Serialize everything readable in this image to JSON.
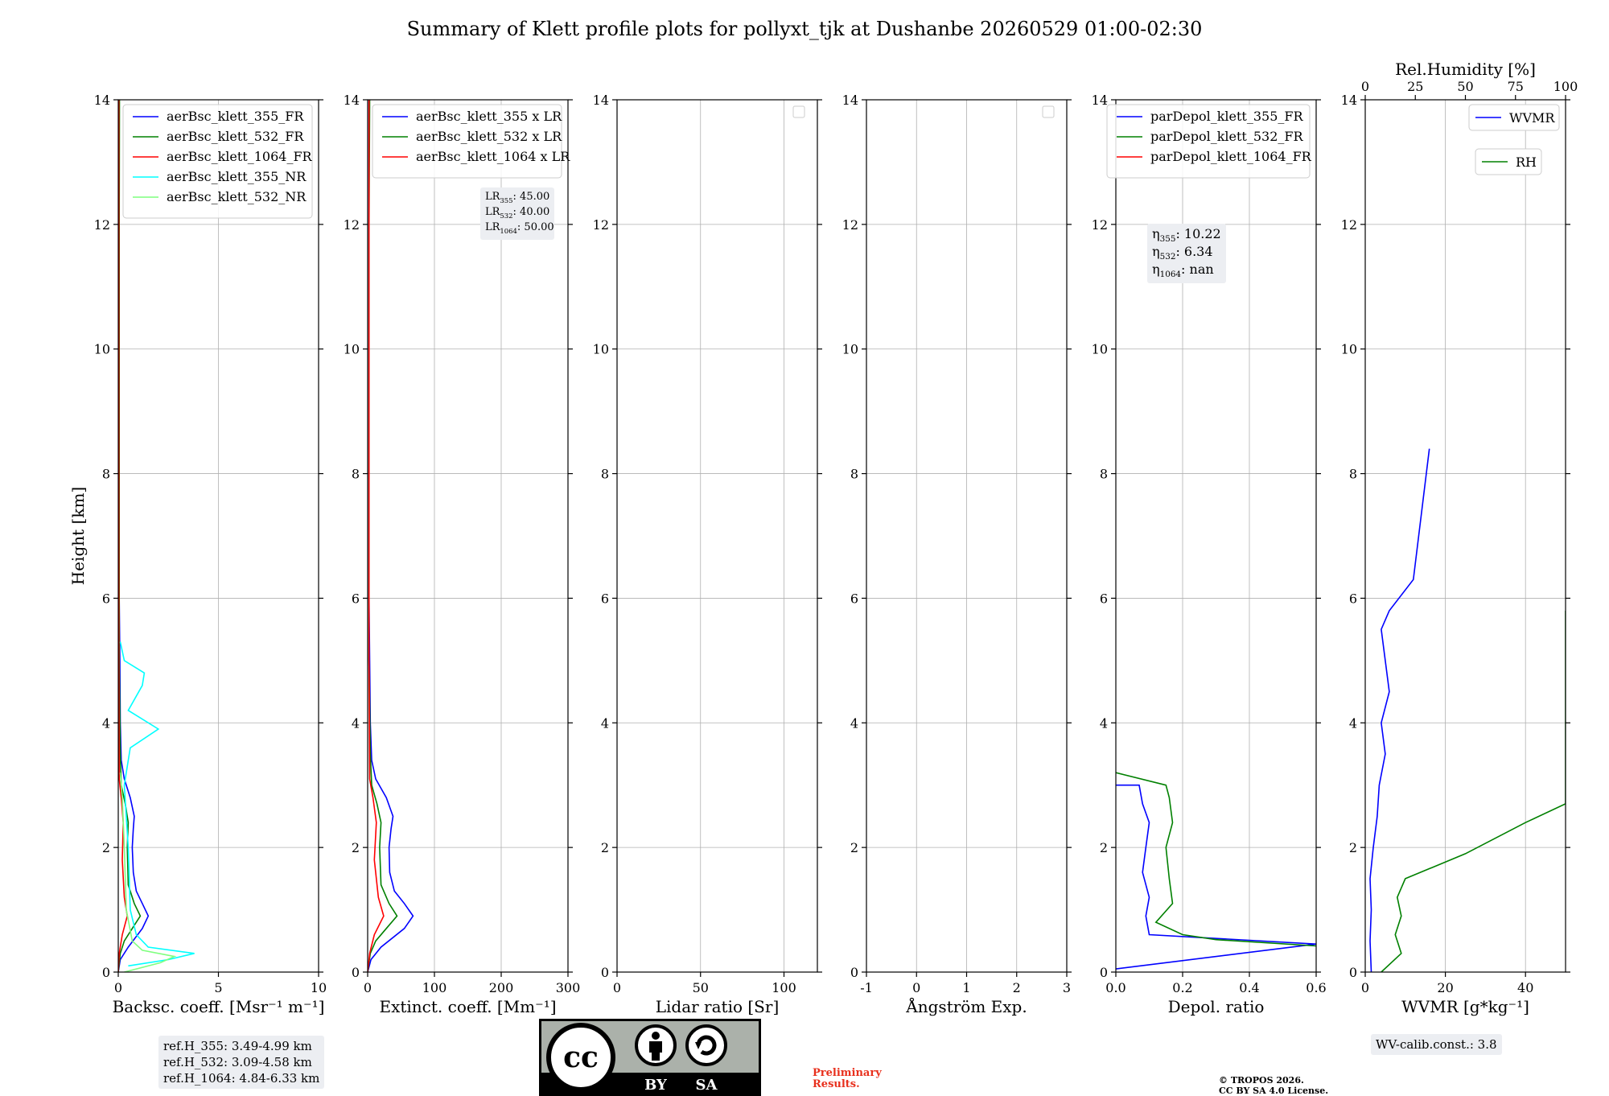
{
  "title": "Summary of Klett profile plots for pollyxt_tjk at Dushanbe 20260529 01:00-02:30",
  "colors": {
    "blue": "#0000ff",
    "green": "#008000",
    "red": "#ff0000",
    "cyan": "#00ffff",
    "lightgreen": "#7fff7f"
  },
  "shared_ylabel": "Height [km]",
  "reference_heights": [
    "ref.H_355: 3.49-4.99 km",
    "ref.H_532: 3.09-4.58 km",
    "ref.H_1064: 4.84-6.33 km"
  ],
  "wv_calib": "WV-calib.const.: 3.8",
  "preliminary": [
    "Preliminary",
    "Results."
  ],
  "copyright": [
    "© TROPOS 2026.",
    "CC BY SA 4.0 License."
  ],
  "license_badge": {
    "icon": "creative-commons-by-sa-badge",
    "by": "BY",
    "sa": "SA",
    "cc": "cc"
  },
  "chart_data": [
    {
      "type": "line",
      "xlabel": "Backsc. coeff. [Msr⁻¹ m⁻¹]",
      "ylabel": "Height [km]",
      "xlim": [
        0,
        10
      ],
      "ylim": [
        0,
        14
      ],
      "xticks": [
        0,
        5,
        10
      ],
      "yticks": [
        0,
        2,
        4,
        6,
        8,
        10,
        12,
        14
      ],
      "grid": true,
      "legend_placement": "top-right",
      "series": [
        {
          "name": "aerBsc_klett_355_FR",
          "color": "#0000ff",
          "points": [
            [
              0.0,
              0.0
            ],
            [
              0.1,
              0.2
            ],
            [
              0.5,
              0.4
            ],
            [
              1.2,
              0.7
            ],
            [
              1.5,
              0.9
            ],
            [
              1.2,
              1.1
            ],
            [
              0.9,
              1.3
            ],
            [
              0.75,
              1.6
            ],
            [
              0.7,
              2.0
            ],
            [
              0.75,
              2.3
            ],
            [
              0.8,
              2.5
            ],
            [
              0.6,
              2.8
            ],
            [
              0.3,
              3.1
            ],
            [
              0.15,
              3.4
            ],
            [
              0.1,
              4.0
            ],
            [
              0.08,
              5.0
            ],
            [
              0.05,
              6.0
            ],
            [
              0.05,
              7.0
            ],
            [
              0.05,
              8.0
            ],
            [
              0.04,
              10.0
            ],
            [
              0.04,
              12.0
            ],
            [
              0.05,
              14.0
            ]
          ]
        },
        {
          "name": "aerBsc_klett_532_FR",
          "color": "#008000",
          "points": [
            [
              0.0,
              0.0
            ],
            [
              0.1,
              0.3
            ],
            [
              0.3,
              0.5
            ],
            [
              0.7,
              0.7
            ],
            [
              1.1,
              0.9
            ],
            [
              0.8,
              1.1
            ],
            [
              0.5,
              1.4
            ],
            [
              0.45,
              2.0
            ],
            [
              0.5,
              2.4
            ],
            [
              0.35,
              2.7
            ],
            [
              0.15,
              3.0
            ],
            [
              0.1,
              3.5
            ],
            [
              0.05,
              5.0
            ],
            [
              0.05,
              8.0
            ],
            [
              0.05,
              12.0
            ],
            [
              0.06,
              14.0
            ]
          ]
        },
        {
          "name": "aerBsc_klett_1064_FR",
          "color": "#ff0000",
          "points": [
            [
              0.0,
              0.0
            ],
            [
              0.05,
              0.3
            ],
            [
              0.2,
              0.6
            ],
            [
              0.45,
              0.9
            ],
            [
              0.3,
              1.2
            ],
            [
              0.2,
              1.8
            ],
            [
              0.25,
              2.4
            ],
            [
              0.15,
              2.8
            ],
            [
              0.05,
              3.1
            ],
            [
              0.03,
              5.0
            ],
            [
              0.03,
              9.0
            ],
            [
              0.03,
              14.0
            ]
          ]
        },
        {
          "name": "aerBsc_klett_355_NR",
          "color": "#00ffff",
          "points": [
            [
              0.5,
              0.1
            ],
            [
              2.5,
              0.2
            ],
            [
              3.8,
              0.3
            ],
            [
              1.5,
              0.4
            ],
            [
              0.9,
              0.6
            ],
            [
              0.6,
              1.0
            ],
            [
              0.5,
              2.0
            ],
            [
              0.3,
              3.0
            ],
            [
              0.6,
              3.6
            ],
            [
              2.0,
              3.9
            ],
            [
              0.5,
              4.2
            ],
            [
              1.2,
              4.6
            ],
            [
              1.3,
              4.8
            ],
            [
              0.3,
              5.0
            ],
            [
              0.1,
              5.3
            ]
          ]
        },
        {
          "name": "aerBsc_klett_532_NR",
          "color": "#7fff7f",
          "points": [
            [
              0.3,
              0.0
            ],
            [
              2.1,
              0.15
            ],
            [
              2.8,
              0.25
            ],
            [
              1.2,
              0.35
            ],
            [
              0.7,
              0.5
            ],
            [
              0.4,
              1.0
            ],
            [
              0.3,
              2.0
            ],
            [
              0.2,
              2.8
            ],
            [
              0.1,
              3.2
            ]
          ]
        }
      ]
    },
    {
      "type": "line",
      "xlabel": "Extinct. coeff. [Mm⁻¹]",
      "xlim": [
        0,
        300
      ],
      "ylim": [
        0,
        14
      ],
      "xticks": [
        0,
        100,
        200,
        300
      ],
      "yticks": [
        0,
        2,
        4,
        6,
        8,
        10,
        12,
        14
      ],
      "grid": true,
      "legend_placement": "top-right",
      "lidar_ratios": [
        "LR355: 45.00",
        "LR532: 40.00",
        "LR1064: 50.00"
      ],
      "series": [
        {
          "name": "aerBsc_klett_355 x LR",
          "color": "#0000ff",
          "points": [
            [
              0,
              0.0
            ],
            [
              5,
              0.2
            ],
            [
              20,
              0.4
            ],
            [
              55,
              0.7
            ],
            [
              68,
              0.9
            ],
            [
              55,
              1.1
            ],
            [
              40,
              1.3
            ],
            [
              33,
              1.6
            ],
            [
              32,
              2.0
            ],
            [
              35,
              2.3
            ],
            [
              38,
              2.5
            ],
            [
              28,
              2.8
            ],
            [
              12,
              3.1
            ],
            [
              6,
              3.4
            ],
            [
              4,
              4.0
            ],
            [
              3,
              5.0
            ],
            [
              2,
              6.0
            ],
            [
              2,
              8.0
            ],
            [
              2,
              10.0
            ],
            [
              2,
              12.0
            ],
            [
              2,
              14.0
            ]
          ]
        },
        {
          "name": "aerBsc_klett_532 x LR",
          "color": "#008000",
          "points": [
            [
              0,
              0.0
            ],
            [
              4,
              0.3
            ],
            [
              12,
              0.5
            ],
            [
              28,
              0.7
            ],
            [
              44,
              0.9
            ],
            [
              32,
              1.1
            ],
            [
              20,
              1.4
            ],
            [
              18,
              2.0
            ],
            [
              20,
              2.4
            ],
            [
              14,
              2.7
            ],
            [
              6,
              3.0
            ],
            [
              4,
              3.5
            ],
            [
              2,
              5.0
            ],
            [
              2,
              8.0
            ],
            [
              2,
              12.0
            ],
            [
              3,
              14.0
            ]
          ]
        },
        {
          "name": "aerBsc_klett_1064 x LR",
          "color": "#ff0000",
          "points": [
            [
              0,
              0.0
            ],
            [
              3,
              0.3
            ],
            [
              10,
              0.6
            ],
            [
              24,
              0.9
            ],
            [
              16,
              1.2
            ],
            [
              10,
              1.8
            ],
            [
              13,
              2.4
            ],
            [
              8,
              2.8
            ],
            [
              3,
              3.1
            ],
            [
              2,
              5.0
            ],
            [
              2,
              9.0
            ],
            [
              2,
              14.0
            ]
          ]
        }
      ]
    },
    {
      "type": "line",
      "xlabel": "Lidar ratio [Sr]",
      "xlim": [
        0,
        120
      ],
      "ylim": [
        0,
        14
      ],
      "xticks": [
        0,
        50,
        100
      ],
      "yticks": [
        0,
        2,
        4,
        6,
        8,
        10,
        12,
        14
      ],
      "grid": true,
      "legend_placement": "top-right",
      "series": []
    },
    {
      "type": "line",
      "xlabel": "Ångström Exp.",
      "xlim": [
        -1,
        3
      ],
      "ylim": [
        0,
        14
      ],
      "xticks": [
        -1,
        0,
        1,
        2,
        3
      ],
      "yticks": [
        0,
        2,
        4,
        6,
        8,
        10,
        12,
        14
      ],
      "grid": true,
      "legend_placement": "top-right",
      "series": []
    },
    {
      "type": "line",
      "xlabel": "Depol. ratio",
      "xlim": [
        0,
        0.6
      ],
      "ylim": [
        0,
        14
      ],
      "xticks": [
        0.0,
        0.2,
        0.4,
        0.6
      ],
      "xticklabels": [
        "0.0",
        "0.2",
        "0.4",
        "0.6"
      ],
      "yticks": [
        0,
        2,
        4,
        6,
        8,
        10,
        12,
        14
      ],
      "grid": true,
      "legend_placement": "top-right",
      "depol_constants": [
        "η355: 10.22",
        "η532: 6.34",
        "η1064: nan"
      ],
      "series": [
        {
          "name": "parDepol_klett_355_FR",
          "color": "#0000ff",
          "points": [
            [
              0.0,
              0.05
            ],
            [
              0.6,
              0.45
            ],
            [
              0.1,
              0.6
            ],
            [
              0.09,
              0.9
            ],
            [
              0.1,
              1.2
            ],
            [
              0.08,
              1.6
            ],
            [
              0.09,
              2.0
            ],
            [
              0.1,
              2.4
            ],
            [
              0.08,
              2.7
            ],
            [
              0.07,
              3.0
            ],
            [
              0.0,
              3.0
            ]
          ]
        },
        {
          "name": "parDepol_klett_532_FR",
          "color": "#008000",
          "points": [
            [
              0.6,
              0.42
            ],
            [
              0.3,
              0.52
            ],
            [
              0.2,
              0.6
            ],
            [
              0.12,
              0.8
            ],
            [
              0.17,
              1.1
            ],
            [
              0.16,
              1.5
            ],
            [
              0.15,
              2.0
            ],
            [
              0.17,
              2.4
            ],
            [
              0.16,
              2.8
            ],
            [
              0.15,
              3.0
            ],
            [
              0.0,
              3.2
            ]
          ]
        },
        {
          "name": "parDepol_klett_1064_FR",
          "color": "#ff0000",
          "points": []
        }
      ]
    },
    {
      "type": "line",
      "xlabel": "WVMR [g*kg⁻¹]",
      "xlim": [
        0,
        50
      ],
      "ylim": [
        0,
        14
      ],
      "xticks": [
        0,
        20,
        40
      ],
      "yticks": [
        0,
        2,
        4,
        6,
        8,
        10,
        12,
        14
      ],
      "top_axis": {
        "label": "Rel.Humidity [%]",
        "xlim": [
          0,
          100
        ],
        "xticks": [
          0,
          25,
          50,
          75,
          100
        ]
      },
      "grid": true,
      "legend_placement": "top-right",
      "series": [
        {
          "name": "WVMR",
          "color": "#0000ff",
          "points": [
            [
              1.5,
              0.0
            ],
            [
              1.2,
              0.5
            ],
            [
              1.5,
              1.0
            ],
            [
              1.2,
              1.5
            ],
            [
              2.0,
              2.0
            ],
            [
              3.0,
              2.5
            ],
            [
              3.5,
              3.0
            ],
            [
              5.0,
              3.5
            ],
            [
              4.0,
              4.0
            ],
            [
              6.0,
              4.5
            ],
            [
              5.0,
              5.0
            ],
            [
              4.0,
              5.5
            ],
            [
              6.0,
              5.8
            ],
            [
              12.0,
              6.3
            ],
            [
              16.0,
              8.4
            ]
          ]
        },
        {
          "name": "RH",
          "color": "#008000",
          "points": [
            [
              8,
              0.0
            ],
            [
              18,
              0.3
            ],
            [
              15,
              0.6
            ],
            [
              18,
              0.9
            ],
            [
              16,
              1.2
            ],
            [
              20,
              1.5
            ],
            [
              50,
              1.9
            ],
            [
              80,
              2.4
            ],
            [
              100,
              2.7
            ],
            [
              100,
              3.2
            ],
            [
              100,
              4.2
            ],
            [
              100,
              5.8
            ]
          ]
        }
      ]
    }
  ]
}
